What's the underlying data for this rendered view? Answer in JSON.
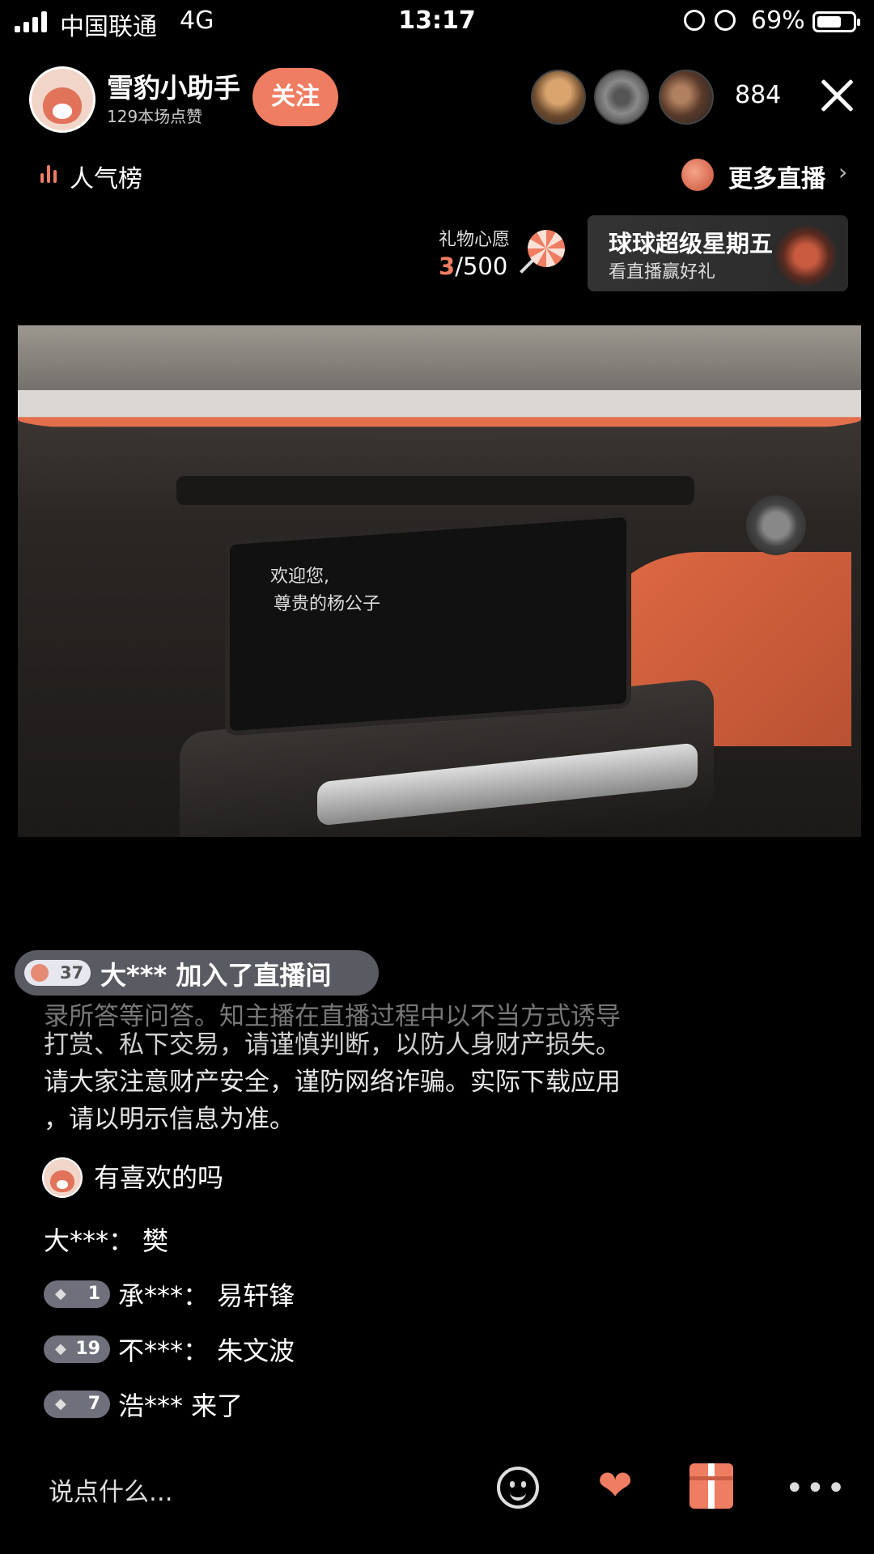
{
  "status_bar": {
    "carrier": "中国联通",
    "network": "4G",
    "time": "13:17",
    "battery_pct": "69%",
    "battery_level": 0.69
  },
  "host": {
    "name": "雪豹小助手",
    "likes": "129本场点赞",
    "follow_label": "关注"
  },
  "viewers": {
    "count": "884"
  },
  "nav": {
    "ranking_label": "人气榜",
    "more_live_label": "更多直播",
    "more_chevron": "›"
  },
  "gift_wish": {
    "label": "礼物心愿",
    "current": "3",
    "total": "/500"
  },
  "promo": {
    "title": "球球超级星期五",
    "subtitle": "看直播赢好礼"
  },
  "video": {
    "screen_line1": "欢迎您,",
    "screen_line2": "尊贵的杨公子"
  },
  "chat": {
    "join_badge_level": "37",
    "join_text": "大*** 加入了直播间",
    "notice_fade": "录所答等问答。知主播在直播过程中以不当方式诱导",
    "notice_line1": "打赏、私下交易，请谨慎判断，以防人身财产损失。",
    "notice_line2": "请大家注意财产安全，谨防网络诈骗。实际下载应用",
    "notice_line3": "，请以明示信息为准。",
    "messages": [
      {
        "text": "有喜欢的吗"
      },
      {
        "text": "大***：  樊"
      },
      {
        "level": "1",
        "text": "承***：  易轩锋"
      },
      {
        "level": "19",
        "text": "不***：  朱文波"
      },
      {
        "level": "7",
        "text": "浩*** 来了"
      }
    ]
  },
  "bottom_bar": {
    "input_placeholder": "说点什么...",
    "more_label": "•••"
  },
  "colors": {
    "accent": "#ef7d62",
    "background": "#000000",
    "badge": "#9696a5"
  }
}
